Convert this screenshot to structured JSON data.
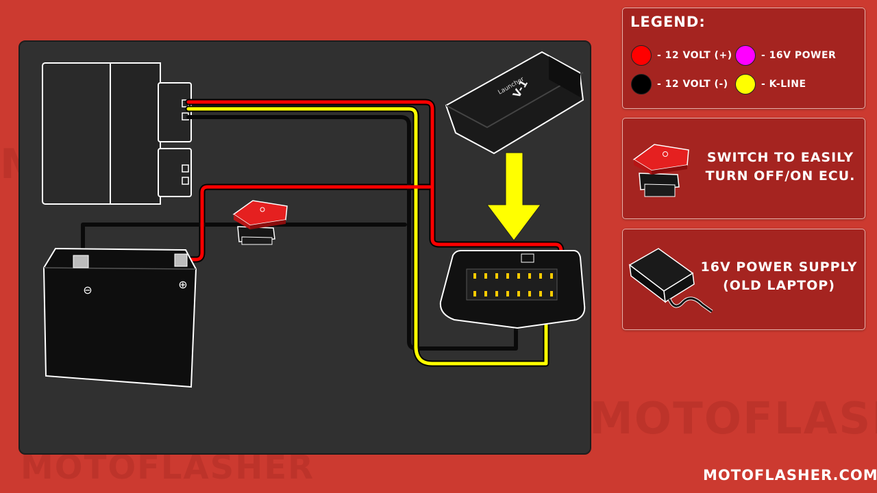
{
  "legend": {
    "title": "LEGEND:",
    "items": [
      {
        "label": "- 12 VOLT (+)",
        "color": "#ff0000"
      },
      {
        "label": "- 12 VOLT (-)",
        "color": "#000000"
      },
      {
        "label": "- 16V POWER",
        "color": "#ff00ff"
      },
      {
        "label": "- K-LINE",
        "color": "#ffff00"
      }
    ]
  },
  "switch_panel": {
    "line1": "SWITCH TO EASILY",
    "line2": "TURN OFF/ON ECU.",
    "icon": "rocker-switch-icon"
  },
  "supply_panel": {
    "line1": "16V POWER SUPPLY",
    "line2": "(OLD LAPTOP)",
    "icon": "power-adapter-icon"
  },
  "diagram": {
    "interface_label": "Launcher",
    "interface_model": "V-1",
    "battery_minus": "⊖",
    "battery_plus": "⊕",
    "wire_colors": {
      "positive": "#ff0000",
      "negative": "#000000",
      "kline": "#ffff00",
      "power16v": "#ff00ff"
    }
  },
  "watermark": "MOTOFLASHER",
  "footer": {
    "site": "MOTOFLASHER.COM"
  },
  "colors": {
    "background": "#cc3a30",
    "panel": "#a52420",
    "board": "#303030"
  }
}
